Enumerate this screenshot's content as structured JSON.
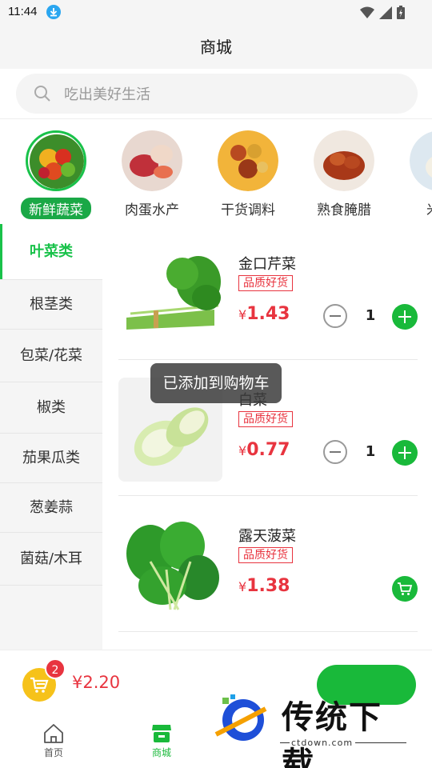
{
  "status": {
    "time": "11:44"
  },
  "header": {
    "title": "商城"
  },
  "search": {
    "placeholder": "吃出美好生活"
  },
  "categories": [
    {
      "label": "新鲜蔬菜",
      "active": true
    },
    {
      "label": "肉蛋水产",
      "active": false
    },
    {
      "label": "干货调料",
      "active": false
    },
    {
      "label": "熟食腌腊",
      "active": false
    },
    {
      "label": "米面",
      "active": false
    }
  ],
  "sidebar": {
    "items": [
      {
        "label": "叶菜类",
        "active": true
      },
      {
        "label": "根茎类",
        "active": false
      },
      {
        "label": "包菜/花菜",
        "active": false
      },
      {
        "label": "椒类",
        "active": false
      },
      {
        "label": "茄果瓜类",
        "active": false
      },
      {
        "label": "葱姜蒜",
        "active": false
      },
      {
        "label": "菌菇/木耳",
        "active": false
      }
    ]
  },
  "products": [
    {
      "name": "金口芹菜",
      "tag": "品质好货",
      "currency": "¥",
      "price": "1.43",
      "qty": "1"
    },
    {
      "name": "白菜",
      "tag": "品质好货",
      "currency": "¥",
      "price": "0.77",
      "qty": "1"
    },
    {
      "name": "露天菠菜",
      "tag": "品质好货",
      "currency": "¥",
      "price": "1.38",
      "qty": ""
    }
  ],
  "toast": {
    "text": "已添加到购物车"
  },
  "cart": {
    "count": "2",
    "total": "¥2.20"
  },
  "tabs": [
    {
      "label": "首页",
      "active": false
    },
    {
      "label": "商城",
      "active": true
    }
  ],
  "watermark": {
    "brand": "传统下载",
    "url": "ctdown.com"
  },
  "colors": {
    "accent": "#19b93a",
    "price": "#e8343f",
    "cart": "#f6c21a"
  }
}
